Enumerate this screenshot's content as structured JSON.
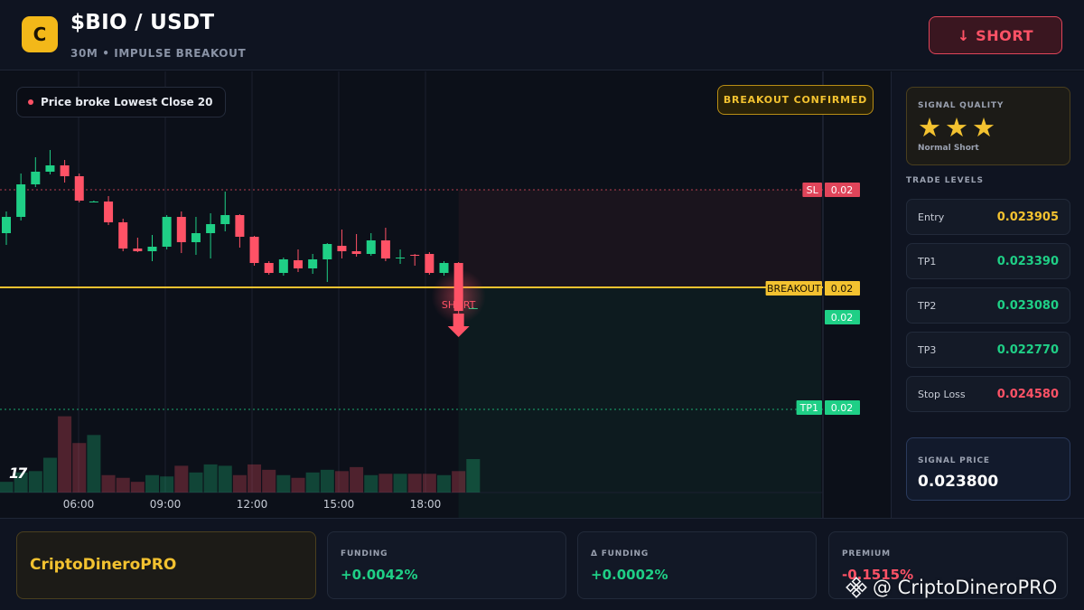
{
  "header": {
    "logo_letter": "C",
    "pair": "$BIO / USDT",
    "subtitle": "30M • IMPULSE BREAKOUT",
    "short_button": "↓ SHORT"
  },
  "chart": {
    "alert": "Price broke Lowest Close 20",
    "badge": "BREAKOUT CONFIRMED",
    "tv_logo": "17",
    "signal_marker": "SHORT",
    "time_labels": [
      "06:00",
      "09:00",
      "12:00",
      "15:00",
      "18:00"
    ],
    "price_tags": {
      "sl": {
        "label": "SL",
        "value": "0.02"
      },
      "breakout": {
        "label": "BREAKOUT",
        "value": "0.02"
      },
      "current": {
        "value": "0.02"
      },
      "tp1": {
        "label": "TP1",
        "value": "0.02"
      }
    }
  },
  "chart_data": {
    "type": "candlestick",
    "x_ticks": [
      "06:00",
      "09:00",
      "12:00",
      "15:00",
      "18:00"
    ],
    "candles": [
      [
        30.0,
        31.8,
        32.4,
        28.7
      ],
      [
        31.8,
        35.4,
        36.6,
        31.4
      ],
      [
        35.4,
        36.8,
        38.4,
        35.1
      ],
      [
        36.8,
        37.5,
        39.2,
        36.5
      ],
      [
        37.5,
        36.3,
        38.1,
        35.6
      ],
      [
        36.3,
        33.6,
        36.6,
        33.4
      ],
      [
        33.5,
        33.5,
        33.6,
        33.4
      ],
      [
        33.5,
        31.2,
        34.1,
        30.9
      ],
      [
        31.2,
        28.3,
        31.6,
        28.0
      ],
      [
        28.3,
        28.0,
        29.5,
        27.9
      ],
      [
        28.0,
        28.5,
        29.8,
        26.9
      ],
      [
        28.5,
        31.8,
        32.0,
        28.2
      ],
      [
        31.8,
        29.0,
        32.4,
        27.8
      ],
      [
        29.0,
        30.0,
        31.8,
        27.6
      ],
      [
        30.0,
        31.0,
        32.2,
        27.2
      ],
      [
        31.0,
        32.0,
        34.6,
        30.2
      ],
      [
        32.0,
        29.6,
        32.1,
        28.4
      ],
      [
        29.6,
        26.7,
        29.7,
        26.4
      ],
      [
        26.7,
        25.6,
        26.9,
        25.4
      ],
      [
        25.6,
        27.1,
        27.3,
        25.3
      ],
      [
        27.0,
        26.1,
        28.2,
        25.7
      ],
      [
        26.1,
        27.1,
        27.7,
        25.5
      ],
      [
        27.1,
        28.8,
        28.9,
        24.6
      ],
      [
        28.6,
        28.0,
        30.4,
        27.2
      ],
      [
        28.0,
        27.7,
        29.9,
        27.4
      ],
      [
        27.7,
        29.2,
        30.0,
        27.5
      ],
      [
        29.2,
        27.2,
        30.6,
        26.9
      ],
      [
        27.2,
        27.3,
        28.2,
        26.6
      ],
      [
        27.6,
        27.5,
        27.7,
        26.4
      ],
      [
        27.7,
        25.6,
        27.9,
        25.4
      ],
      [
        25.6,
        26.7,
        26.9,
        25.3
      ],
      [
        26.7,
        21.4,
        26.8,
        20.5
      ],
      [
        21.7,
        21.7,
        21.8,
        21.6
      ]
    ],
    "volumes": [
      8,
      15,
      16,
      26,
      57,
      37,
      43,
      13,
      11,
      8,
      13,
      12,
      20,
      15,
      21,
      20,
      13,
      21,
      17,
      13,
      11,
      15,
      17,
      16,
      19,
      13,
      14,
      14,
      14,
      14,
      13,
      16,
      25
    ],
    "levels": {
      "sl": 34.8,
      "breakout": 24.0,
      "tp1": 10.5
    },
    "signal_index": 31,
    "price_labels_shown": "0.02"
  },
  "panel": {
    "quality_title": "SIGNAL QUALITY",
    "stars": "★★★",
    "quality_note": "Normal Short",
    "levels_title": "TRADE LEVELS",
    "levels": [
      {
        "label": "Entry",
        "value": "0.023905",
        "color": "#f3c230"
      },
      {
        "label": "TP1",
        "value": "0.023390",
        "color": "#1fcf86"
      },
      {
        "label": "TP2",
        "value": "0.023080",
        "color": "#1fcf86"
      },
      {
        "label": "TP3",
        "value": "0.022770",
        "color": "#1fcf86"
      },
      {
        "label": "Stop Loss",
        "value": "0.024580",
        "color": "#ff5266"
      }
    ],
    "signal_price_title": "SIGNAL PRICE",
    "signal_price": "0.023800"
  },
  "footer": {
    "brand": "CriptoDineroPRO",
    "stats": [
      {
        "label": "FUNDING",
        "value": "+0.0042%",
        "color": "#1fcf86"
      },
      {
        "label": "Δ FUNDING",
        "value": "+0.0002%",
        "color": "#1fcf86"
      },
      {
        "label": "PREMIUM",
        "value": "-0.1515%",
        "color": "#ff5266"
      }
    ],
    "watermark": "@ CriptoDineroPRO"
  },
  "colors": {
    "up": "#1fcf86",
    "down": "#ff5266",
    "accent": "#f3c230"
  }
}
